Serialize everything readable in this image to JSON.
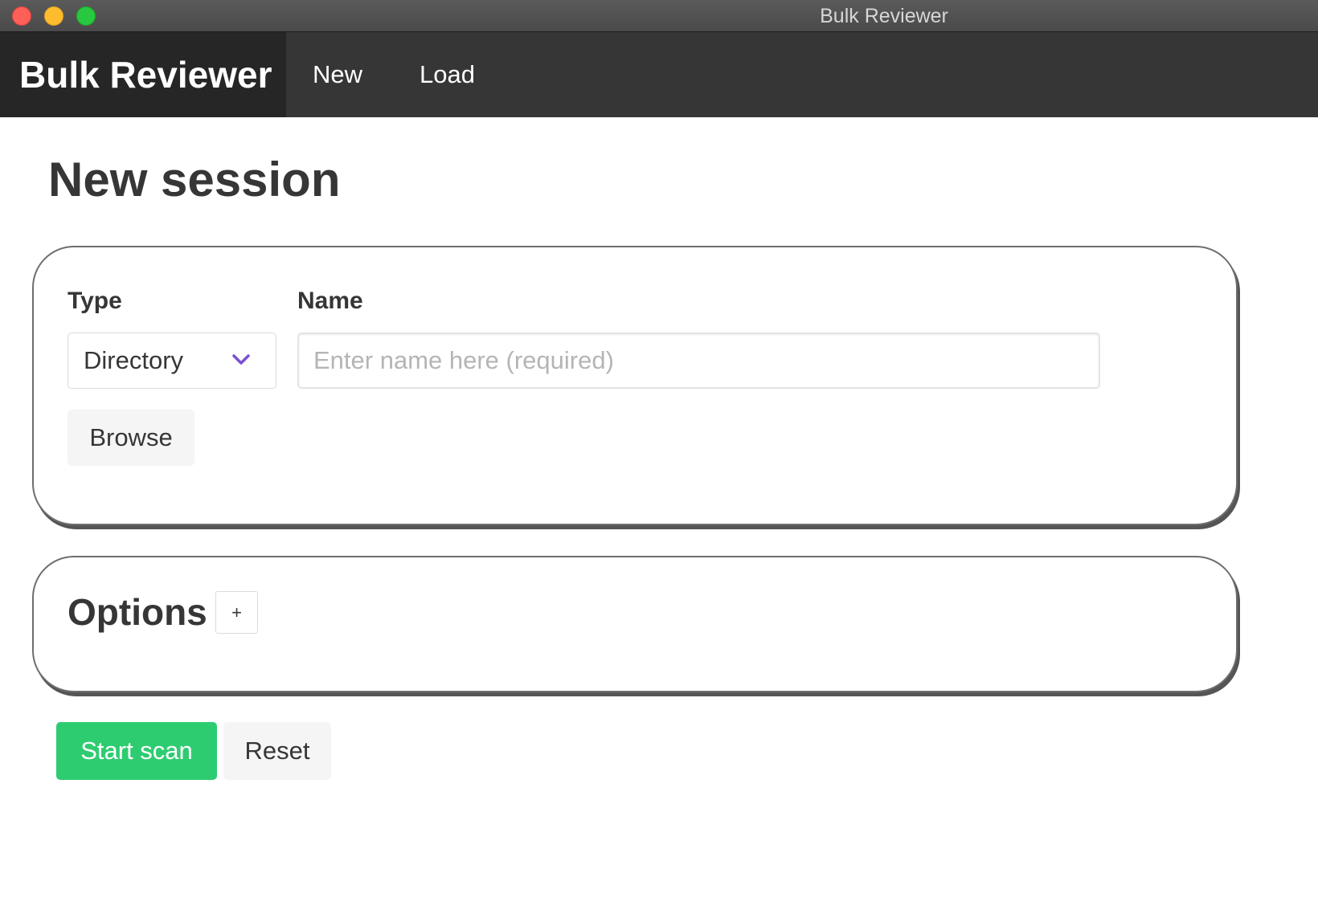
{
  "window": {
    "title": "Bulk Reviewer"
  },
  "navbar": {
    "brand": "Bulk Reviewer",
    "items": [
      {
        "label": "New"
      },
      {
        "label": "Load"
      }
    ]
  },
  "main": {
    "title": "New session",
    "session_form": {
      "type_label": "Type",
      "type_value": "Directory",
      "name_label": "Name",
      "name_value": "",
      "name_placeholder": "Enter name here (required)",
      "browse_label": "Browse"
    },
    "options": {
      "title": "Options",
      "expand_label": "+"
    },
    "actions": {
      "start_label": "Start scan",
      "reset_label": "Reset"
    }
  },
  "colors": {
    "navbar_bg": "#363636",
    "brand_bg": "#262626",
    "primary_button": "#2ecc71",
    "chevron_accent": "#7b4fd6"
  },
  "icons": {
    "select_arrow": "chevron-down-icon"
  }
}
